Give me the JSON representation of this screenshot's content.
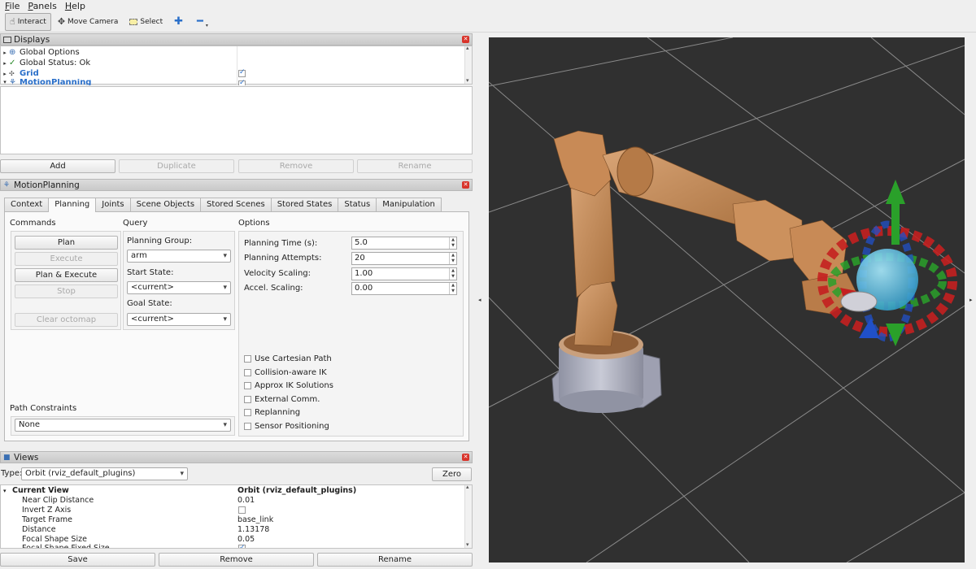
{
  "menubar": {
    "items": [
      {
        "first": "F",
        "rest": "ile"
      },
      {
        "first": "P",
        "rest": "anels"
      },
      {
        "first": "H",
        "rest": "elp"
      }
    ]
  },
  "toolbar": {
    "interact": "Interact",
    "move_camera": "Move Camera",
    "select": "Select"
  },
  "displays": {
    "title": "Displays",
    "items": [
      {
        "label": "Global Options",
        "icon": "globe-icon"
      },
      {
        "label": "Global Status: Ok",
        "icon": "check-icon"
      },
      {
        "label": "Grid",
        "icon": "grid-icon",
        "checked": true
      },
      {
        "label": "MotionPlanning",
        "icon": "robot-icon",
        "checked": true
      }
    ],
    "buttons": {
      "add": "Add",
      "duplicate": "Duplicate",
      "remove": "Remove",
      "rename": "Rename"
    }
  },
  "motion_planning": {
    "title": "MotionPlanning",
    "tabs": [
      "Context",
      "Planning",
      "Joints",
      "Scene Objects",
      "Stored Scenes",
      "Stored States",
      "Status",
      "Manipulation"
    ],
    "selected_tab": "Planning",
    "commands": {
      "heading": "Commands",
      "plan": "Plan",
      "execute": "Execute",
      "plan_execute": "Plan & Execute",
      "stop": "Stop",
      "clear_octomap": "Clear octomap"
    },
    "query": {
      "heading": "Query",
      "planning_group_label": "Planning Group:",
      "planning_group_value": "arm",
      "start_state_label": "Start State:",
      "start_state_value": "<current>",
      "goal_state_label": "Goal State:",
      "goal_state_value": "<current>"
    },
    "options": {
      "heading": "Options",
      "planning_time_label": "Planning Time (s):",
      "planning_time_value": "5.0",
      "planning_attempts_label": "Planning Attempts:",
      "planning_attempts_value": "20",
      "velocity_scaling_label": "Velocity Scaling:",
      "velocity_scaling_value": "1.00",
      "accel_scaling_label": "Accel. Scaling:",
      "accel_scaling_value": "0.00",
      "checkboxes": [
        "Use Cartesian Path",
        "Collision-aware IK",
        "Approx IK Solutions",
        "External Comm.",
        "Replanning",
        "Sensor Positioning"
      ]
    },
    "path_constraints": {
      "label": "Path Constraints",
      "value": "None"
    }
  },
  "views": {
    "title": "Views",
    "type_label": "Type:",
    "type_value": "Orbit (rviz_default_plugins)",
    "zero": "Zero",
    "current_view_label": "Current View",
    "current_view_value": "Orbit (rviz_default_plugins)",
    "properties": [
      {
        "key": "Near Clip Distance",
        "value": "0.01"
      },
      {
        "key": "Invert Z Axis",
        "value": ""
      },
      {
        "key": "Target Frame",
        "value": "base_link"
      },
      {
        "key": "Distance",
        "value": "1.13178"
      },
      {
        "key": "Focal Shape Size",
        "value": "0.05"
      },
      {
        "key": "Focal Shape Fixed Size",
        "value": ""
      }
    ],
    "buttons": {
      "save": "Save",
      "remove": "Remove",
      "rename": "Rename"
    }
  },
  "colors": {
    "viewport_bg": "#303030",
    "grid": "#8a8a8a",
    "robot": "#c8905f",
    "base": "#a9abb8",
    "marker_red": "#c42020",
    "marker_green": "#2aa02a",
    "marker_blue": "#2050c8",
    "sphere": "#45b8e0"
  }
}
